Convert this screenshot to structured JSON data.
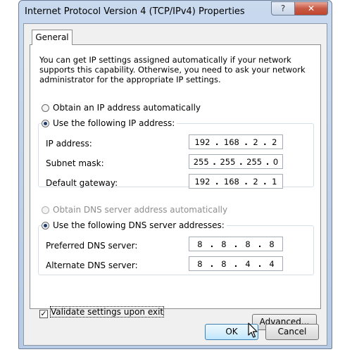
{
  "window": {
    "title": "Internet Protocol Version 4 (TCP/IPv4) Properties",
    "help_label": "?",
    "close_label": "✕"
  },
  "tabs": [
    {
      "label": "General",
      "selected": true
    }
  ],
  "description": "You can get IP settings assigned automatically if your network supports this capability. Otherwise, you need to ask your network administrator for the appropriate IP settings.",
  "ip_mode": {
    "auto_label": "Obtain an IP address automatically",
    "manual_label": "Use the following IP address:",
    "selected": "manual"
  },
  "ip_fields": [
    {
      "label": "IP address:",
      "octets": [
        "192",
        "168",
        "2",
        "2"
      ]
    },
    {
      "label": "Subnet mask:",
      "octets": [
        "255",
        "255",
        "255",
        "0"
      ]
    },
    {
      "label": "Default gateway:",
      "octets": [
        "192",
        "168",
        "2",
        "1"
      ]
    }
  ],
  "dns_mode": {
    "auto_label": "Obtain DNS server address automatically",
    "manual_label": "Use the following DNS server addresses:",
    "selected": "manual",
    "auto_disabled": true
  },
  "dns_fields": [
    {
      "label": "Preferred DNS server:",
      "octets": [
        "8",
        "8",
        "8",
        "8"
      ]
    },
    {
      "label": "Alternate DNS server:",
      "octets": [
        "8",
        "8",
        "4",
        "4"
      ]
    }
  ],
  "validate": {
    "label": "Validate settings upon exit",
    "checked": true,
    "mark": "✓"
  },
  "buttons": {
    "advanced": "Advanced...",
    "ok": "OK",
    "cancel": "Cancel"
  },
  "icons": {
    "cursor": "arrow-cursor-icon"
  }
}
